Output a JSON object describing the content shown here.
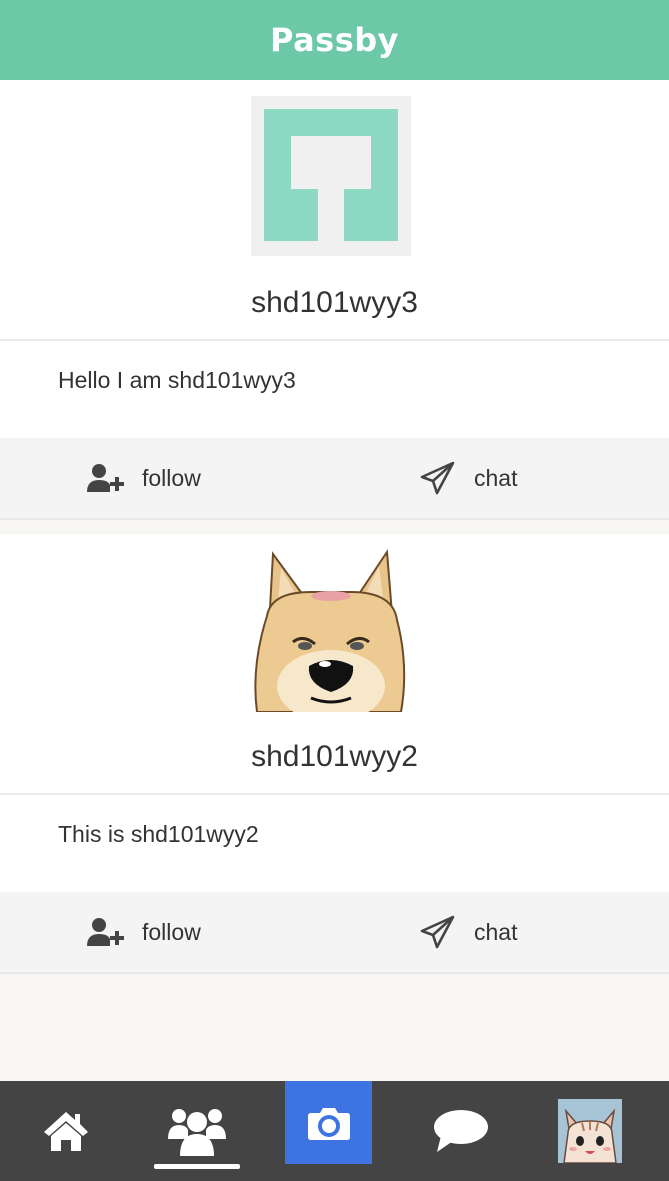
{
  "header": {
    "title": "Passby"
  },
  "users": [
    {
      "name": "shd101wyy3",
      "bio": "Hello I am shd101wyy3",
      "avatar": "default-avatar-icon"
    },
    {
      "name": "shd101wyy2",
      "bio": "This is shd101wyy2",
      "avatar": "dog-avatar"
    }
  ],
  "actions": {
    "follow_label": "follow",
    "chat_label": "chat"
  },
  "tabbar": {
    "items": [
      "home-icon",
      "friends-icon",
      "camera-icon",
      "chat-bubble-icon",
      "profile-avatar"
    ],
    "active": "friends"
  },
  "colors": {
    "header": "#6dc8a7",
    "tabbar": "#444444",
    "camera": "#3e74e2",
    "avatar_tile": "#8ed9c3"
  }
}
